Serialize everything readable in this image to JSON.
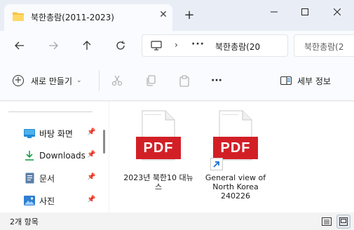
{
  "window": {
    "tab_title": "북한총람(2011-2023)",
    "new_tab_icon": "plus-icon"
  },
  "nav": {
    "address_ellipsis": "···",
    "address_text": "북한총람(20",
    "search_text": "북한총람(2"
  },
  "command_bar": {
    "new_label": "새로 만들기",
    "details_label": "세부 정보",
    "more_label": "···"
  },
  "sidebar": {
    "items": [
      {
        "label": "바탕 화면",
        "icon": "desktop-icon"
      },
      {
        "label": "Downloads",
        "icon": "download-icon"
      },
      {
        "label": "문서",
        "icon": "documents-icon"
      },
      {
        "label": "사진",
        "icon": "pictures-icon"
      }
    ]
  },
  "files": [
    {
      "name": "2023년 북한10 대뉴스",
      "badge": "PDF",
      "shortcut": false
    },
    {
      "name": "General view of North Korea 240226",
      "badge": "PDF",
      "shortcut": true
    }
  ],
  "status": {
    "item_count": "2개 항목"
  },
  "colors": {
    "pdf_red": "#d21f26",
    "folder_yellow": "#f6c343",
    "accent_blue": "#0067c0"
  }
}
